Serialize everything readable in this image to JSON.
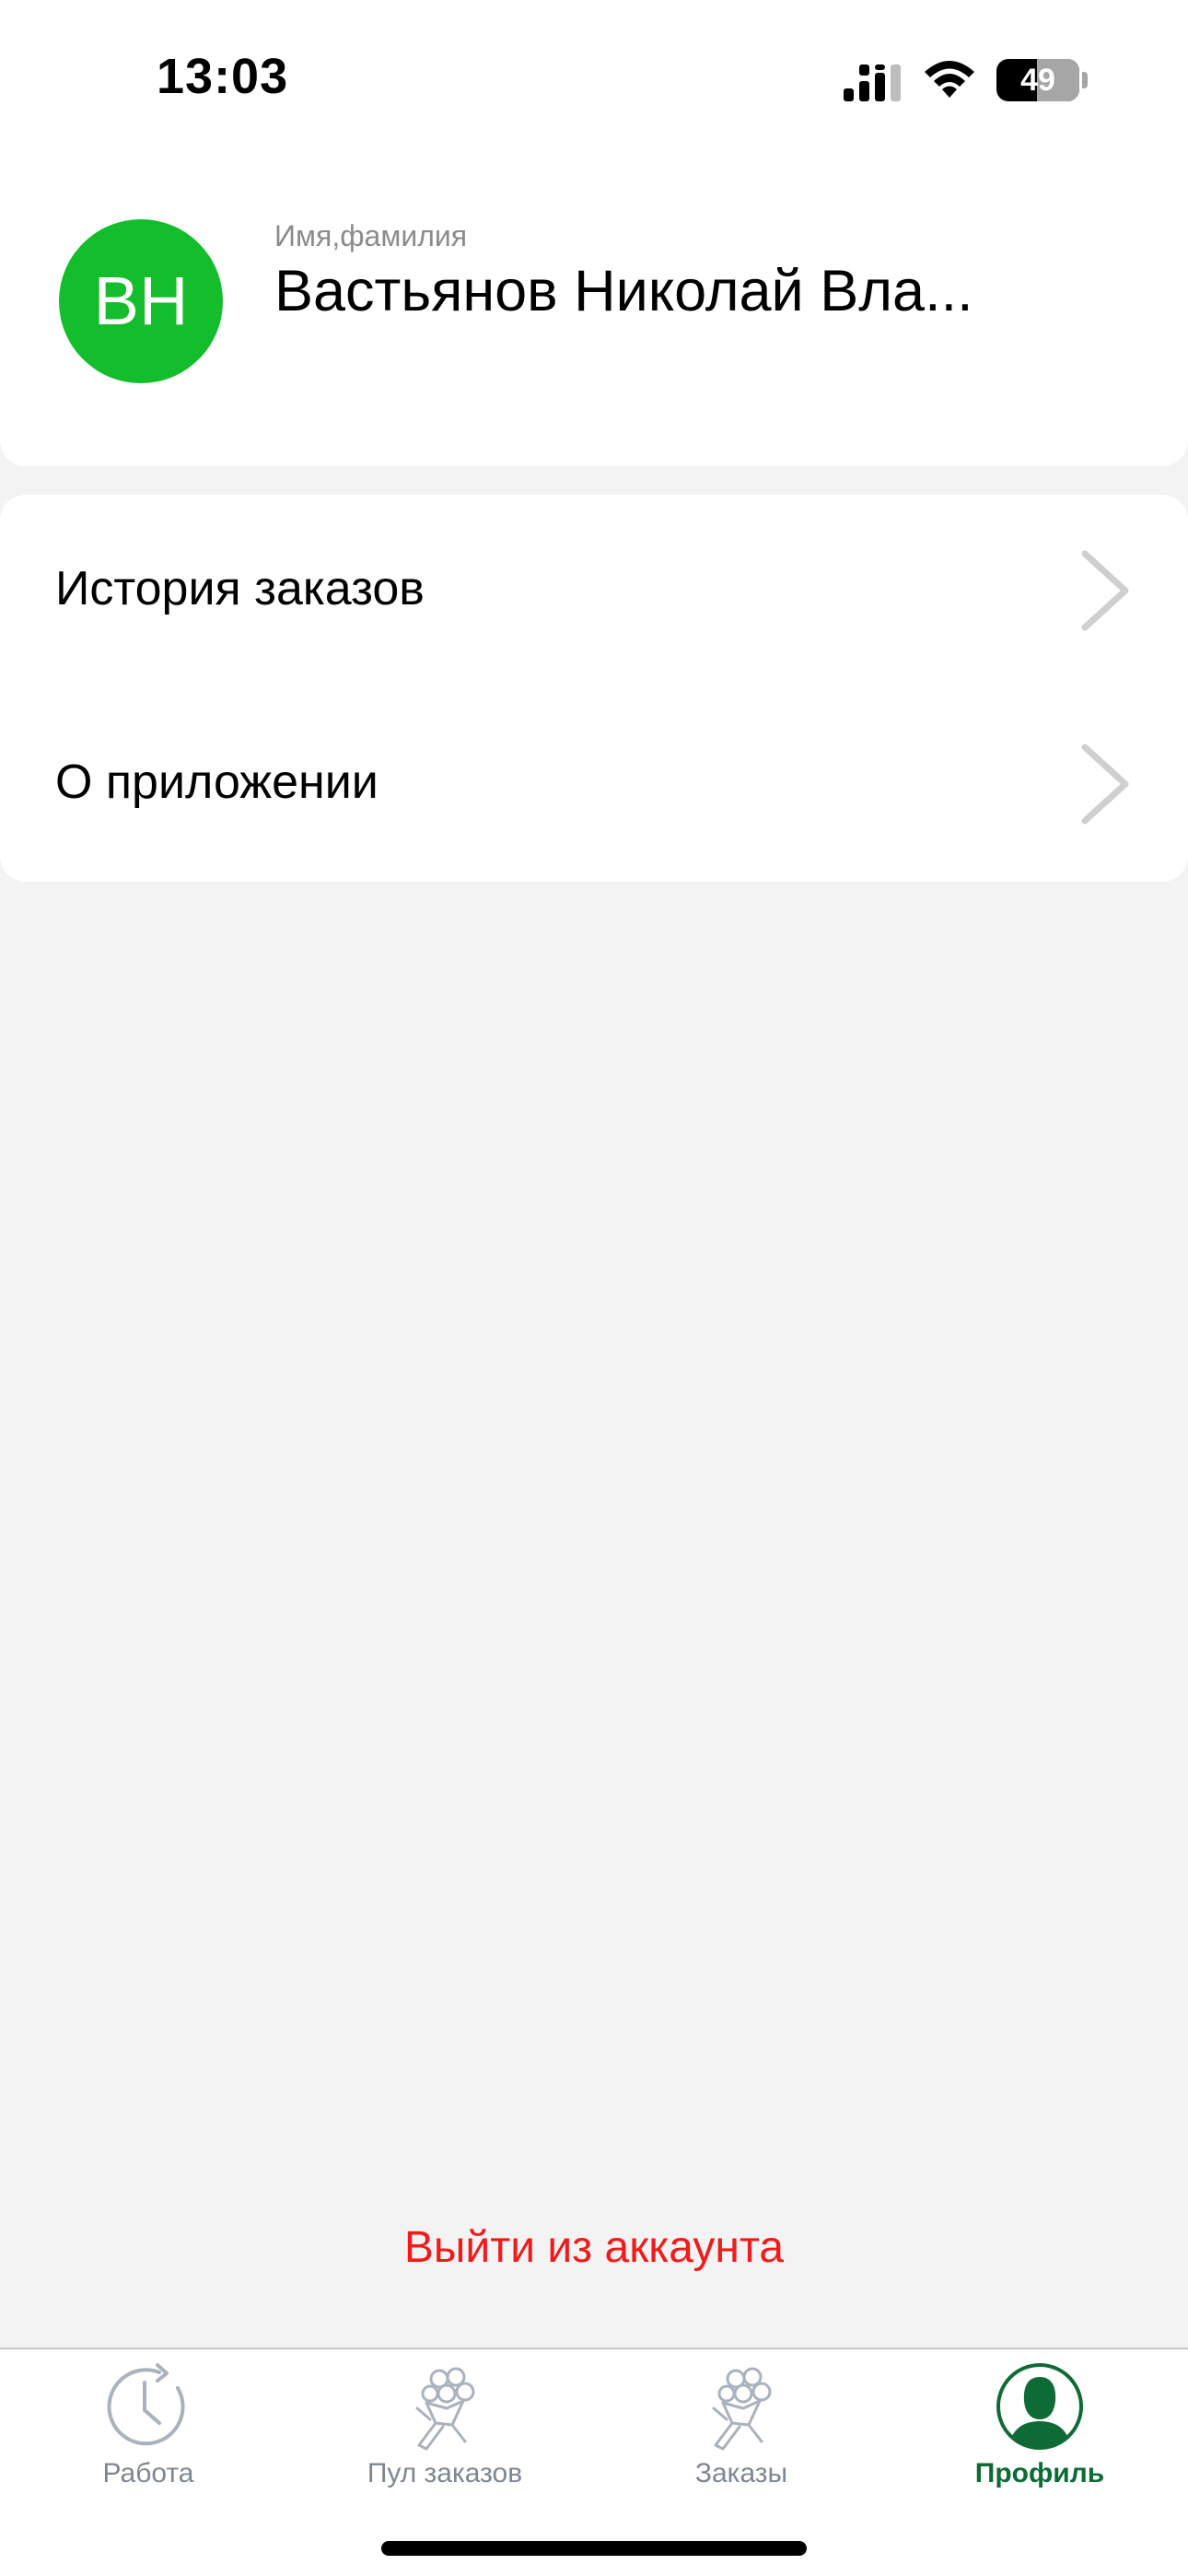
{
  "status_bar": {
    "time": "13:03",
    "battery_percent": "49",
    "battery_level": 0.49
  },
  "profile": {
    "initials": "ВН",
    "name_caption": "Имя,фамилия",
    "name_value": "Вастьянов Николай Вла...",
    "avatar_color": "#14bd2c"
  },
  "menu": {
    "items": [
      {
        "label": "История заказов",
        "icon": "chevron-right-icon"
      },
      {
        "label": "О приложении",
        "icon": "chevron-right-icon"
      }
    ]
  },
  "logout": {
    "label": "Выйти из аккаунта",
    "color": "#f01b1b"
  },
  "tab_bar": {
    "tabs": [
      {
        "label": "Работа",
        "icon": "clock-history-icon",
        "active": false
      },
      {
        "label": "Пул заказов",
        "icon": "bouquet-icon",
        "active": false
      },
      {
        "label": "Заказы",
        "icon": "bouquet-icon",
        "active": false
      },
      {
        "label": "Профиль",
        "icon": "profile-icon",
        "active": true
      }
    ],
    "active_color": "#0f6b35",
    "inactive_color": "#7d8794"
  }
}
